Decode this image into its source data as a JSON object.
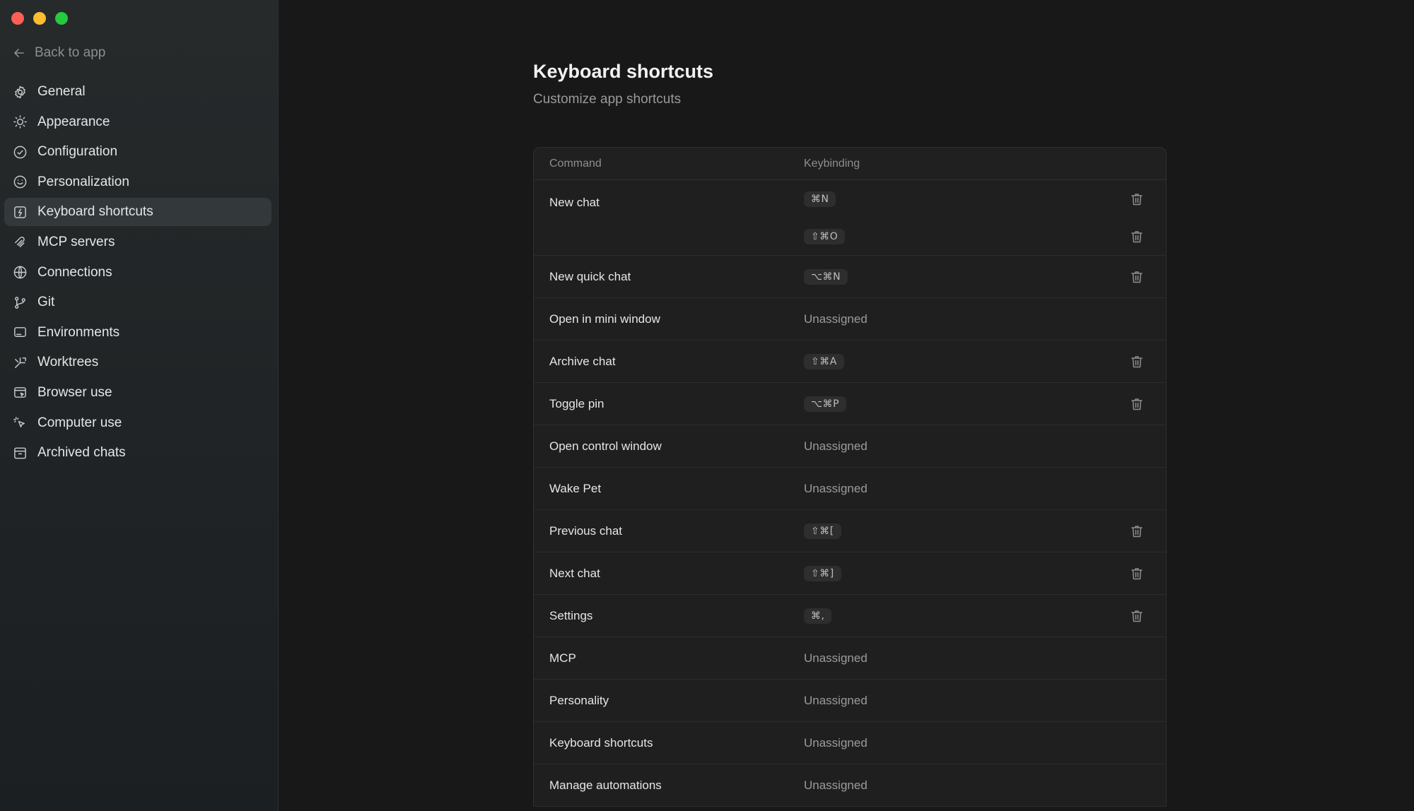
{
  "window": {
    "controls": [
      "close",
      "minimize",
      "maximize"
    ]
  },
  "sidebar": {
    "back_label": "Back to app",
    "items": [
      {
        "label": "General",
        "icon": "gear-icon"
      },
      {
        "label": "Appearance",
        "icon": "sun-icon"
      },
      {
        "label": "Configuration",
        "icon": "shield-icon"
      },
      {
        "label": "Personalization",
        "icon": "smile-icon"
      },
      {
        "label": "Keyboard shortcuts",
        "icon": "keyboard-icon",
        "active": true
      },
      {
        "label": "MCP servers",
        "icon": "mcp-icon"
      },
      {
        "label": "Connections",
        "icon": "globe-icon"
      },
      {
        "label": "Git",
        "icon": "git-branch-icon"
      },
      {
        "label": "Environments",
        "icon": "monitor-icon"
      },
      {
        "label": "Worktrees",
        "icon": "worktree-icon"
      },
      {
        "label": "Browser use",
        "icon": "browser-icon"
      },
      {
        "label": "Computer use",
        "icon": "cursor-icon"
      },
      {
        "label": "Archived chats",
        "icon": "archive-icon"
      }
    ]
  },
  "main": {
    "title": "Keyboard shortcuts",
    "subtitle": "Customize app shortcuts",
    "table": {
      "headers": {
        "command": "Command",
        "keybinding": "Keybinding"
      },
      "unassigned_label": "Unassigned",
      "rows": [
        {
          "command": "New chat",
          "bindings": [
            "⌘N",
            "⇧⌘O"
          ]
        },
        {
          "command": "New quick chat",
          "bindings": [
            "⌥⌘N"
          ]
        },
        {
          "command": "Open in mini window",
          "bindings": []
        },
        {
          "command": "Archive chat",
          "bindings": [
            "⇧⌘A"
          ]
        },
        {
          "command": "Toggle pin",
          "bindings": [
            "⌥⌘P"
          ]
        },
        {
          "command": "Open control window",
          "bindings": []
        },
        {
          "command": "Wake Pet",
          "bindings": []
        },
        {
          "command": "Previous chat",
          "bindings": [
            "⇧⌘["
          ]
        },
        {
          "command": "Next chat",
          "bindings": [
            "⇧⌘]"
          ]
        },
        {
          "command": "Settings",
          "bindings": [
            "⌘,"
          ]
        },
        {
          "command": "MCP",
          "bindings": []
        },
        {
          "command": "Personality",
          "bindings": []
        },
        {
          "command": "Keyboard shortcuts",
          "bindings": []
        },
        {
          "command": "Manage automations",
          "bindings": []
        }
      ]
    }
  },
  "colors": {
    "background": "#181818",
    "sidebar": "#22262a",
    "active_item": "#33383a",
    "kbd_bg": "#2e2e2e"
  }
}
